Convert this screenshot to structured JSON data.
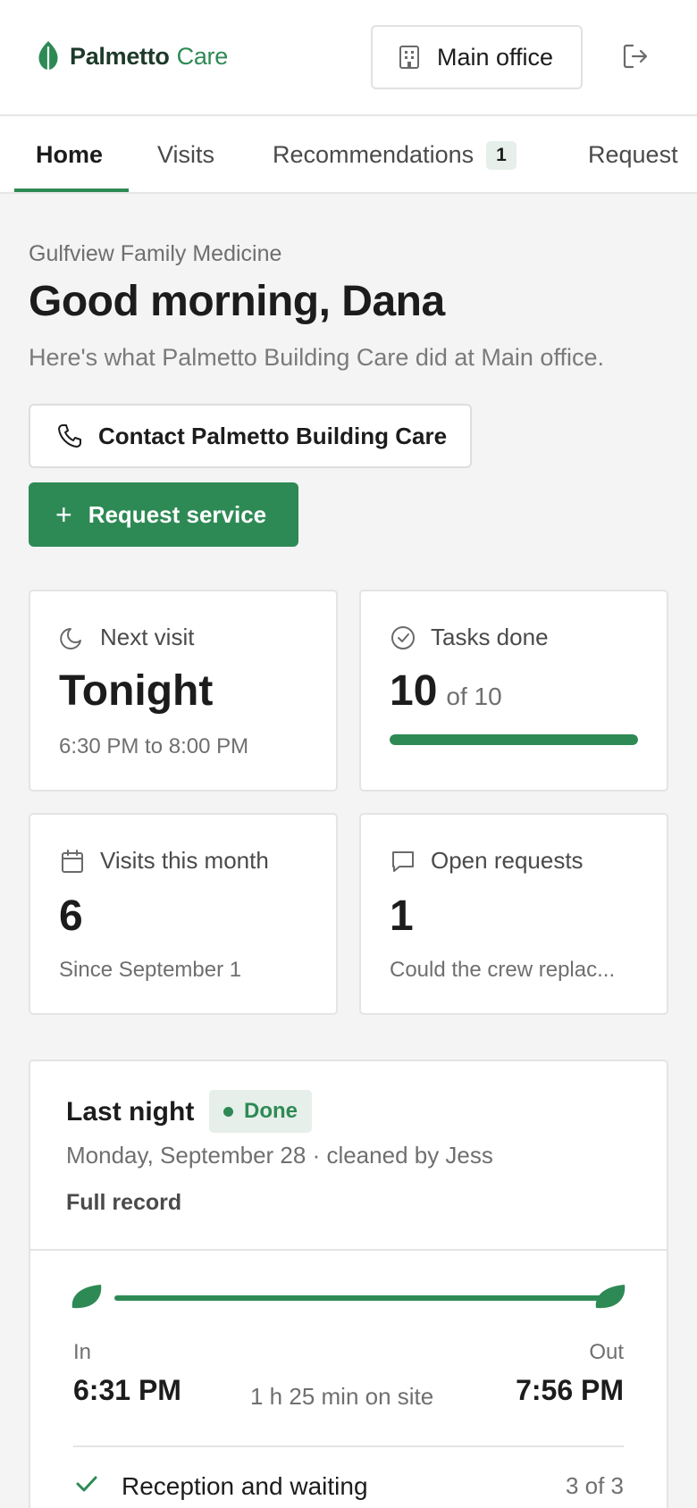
{
  "brand": {
    "name": "Palmetto",
    "suffix": "Care"
  },
  "header": {
    "office_button": "Main office",
    "icons": {
      "office": "building-icon",
      "logout": "logout-icon"
    }
  },
  "tabs": [
    {
      "label": "Home",
      "active": true
    },
    {
      "label": "Visits",
      "active": false
    },
    {
      "label": "Recommendations",
      "badge": "1",
      "active": false
    },
    {
      "label": "Request",
      "active": false
    }
  ],
  "intro": {
    "clinic": "Gulfview Family Medicine",
    "greeting": "Good morning, Dana",
    "subtitle": "Here's what Palmetto Building Care did at Main office.",
    "contact_button": "Contact Palmetto Building Care",
    "request_button": "Request service"
  },
  "stats": {
    "next_visit": {
      "label": "Next visit",
      "value": "Tonight",
      "sub": "6:30 PM to 8:00 PM",
      "icon": "moon-icon"
    },
    "tasks_done": {
      "label": "Tasks done",
      "value": "10",
      "of": "of 10",
      "progress": 1.0,
      "icon": "check-circle-icon"
    },
    "visits_month": {
      "label": "Visits this month",
      "value": "6",
      "sub": "Since September 1",
      "icon": "calendar-icon"
    },
    "open_requests": {
      "label": "Open requests",
      "value": "1",
      "sub": "Could the crew replac...",
      "icon": "chat-icon"
    }
  },
  "last_visit": {
    "title": "Last night",
    "status": "Done",
    "date": "Monday, September 28 · cleaned by Jess",
    "link": "Full record",
    "in_label": "In",
    "in_time": "6:31 PM",
    "out_label": "Out",
    "out_time": "7:56 PM",
    "duration": "1 h 25 min on site",
    "areas": [
      {
        "name": "Reception and waiting",
        "count": "3 of 3"
      }
    ]
  },
  "colors": {
    "accent": "#2e8a55",
    "accent_light": "#e6efe9",
    "brand_dark": "#1d3a2a"
  }
}
